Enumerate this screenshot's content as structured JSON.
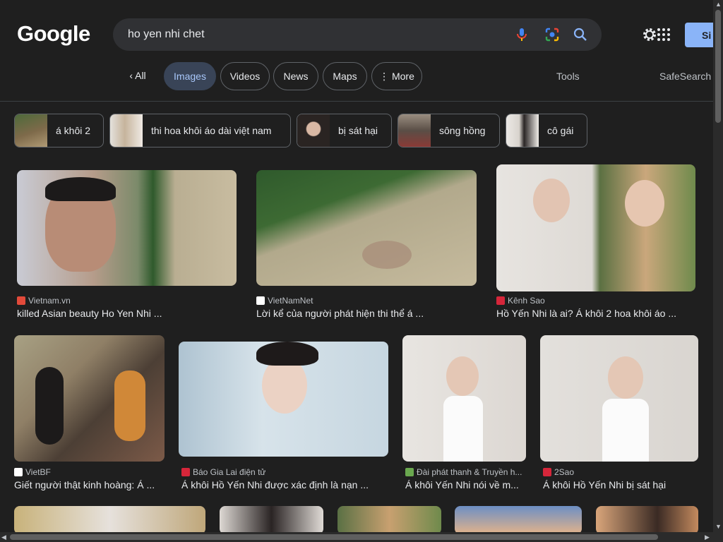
{
  "logo": "Google",
  "search": {
    "query": "ho yen nhi chet"
  },
  "icons": {
    "mic": "mic-icon",
    "lens": "lens-icon",
    "search": "search-icon",
    "settings": "gear-icon",
    "apps": "apps-icon"
  },
  "signin_label": "Si",
  "tabs": {
    "all": "All",
    "images": "Images",
    "videos": "Videos",
    "news": "News",
    "maps": "Maps",
    "more": "More",
    "tools": "Tools",
    "safesearch": "SafeSearch"
  },
  "chips": [
    {
      "label": "á khôi 2"
    },
    {
      "label": "thi hoa khôi áo dài việt nam"
    },
    {
      "label": "bị sát hại"
    },
    {
      "label": "sông hồng"
    },
    {
      "label": "cô gái"
    }
  ],
  "results": [
    {
      "source": "Vietnam.vn",
      "caption": "killed Asian beauty Ho Yen Nhi ..."
    },
    {
      "source": "VietNamNet",
      "caption": "Lời kể của người phát hiện thi thể á ..."
    },
    {
      "source": "Kênh Sao",
      "caption": "Hồ Yến Nhi là ai? Á khôi 2 hoa khôi áo ..."
    },
    {
      "source": "VietBF",
      "caption": "Giết người thật kinh hoàng: Á ..."
    },
    {
      "source": "Báo Gia Lai điện tử",
      "caption": "Á khôi Hồ Yến Nhi được xác định là nạn ..."
    },
    {
      "source": "Đài phát thanh & Truyền h...",
      "caption": "Á khôi Yến Nhi nói về m..."
    },
    {
      "source": "2Sao",
      "caption": "Á khôi Hồ Yến Nhi bị sát hại"
    }
  ],
  "colors": {
    "background": "#1f1f1f",
    "active_tab": "#394457",
    "accent": "#8ab4f8"
  }
}
